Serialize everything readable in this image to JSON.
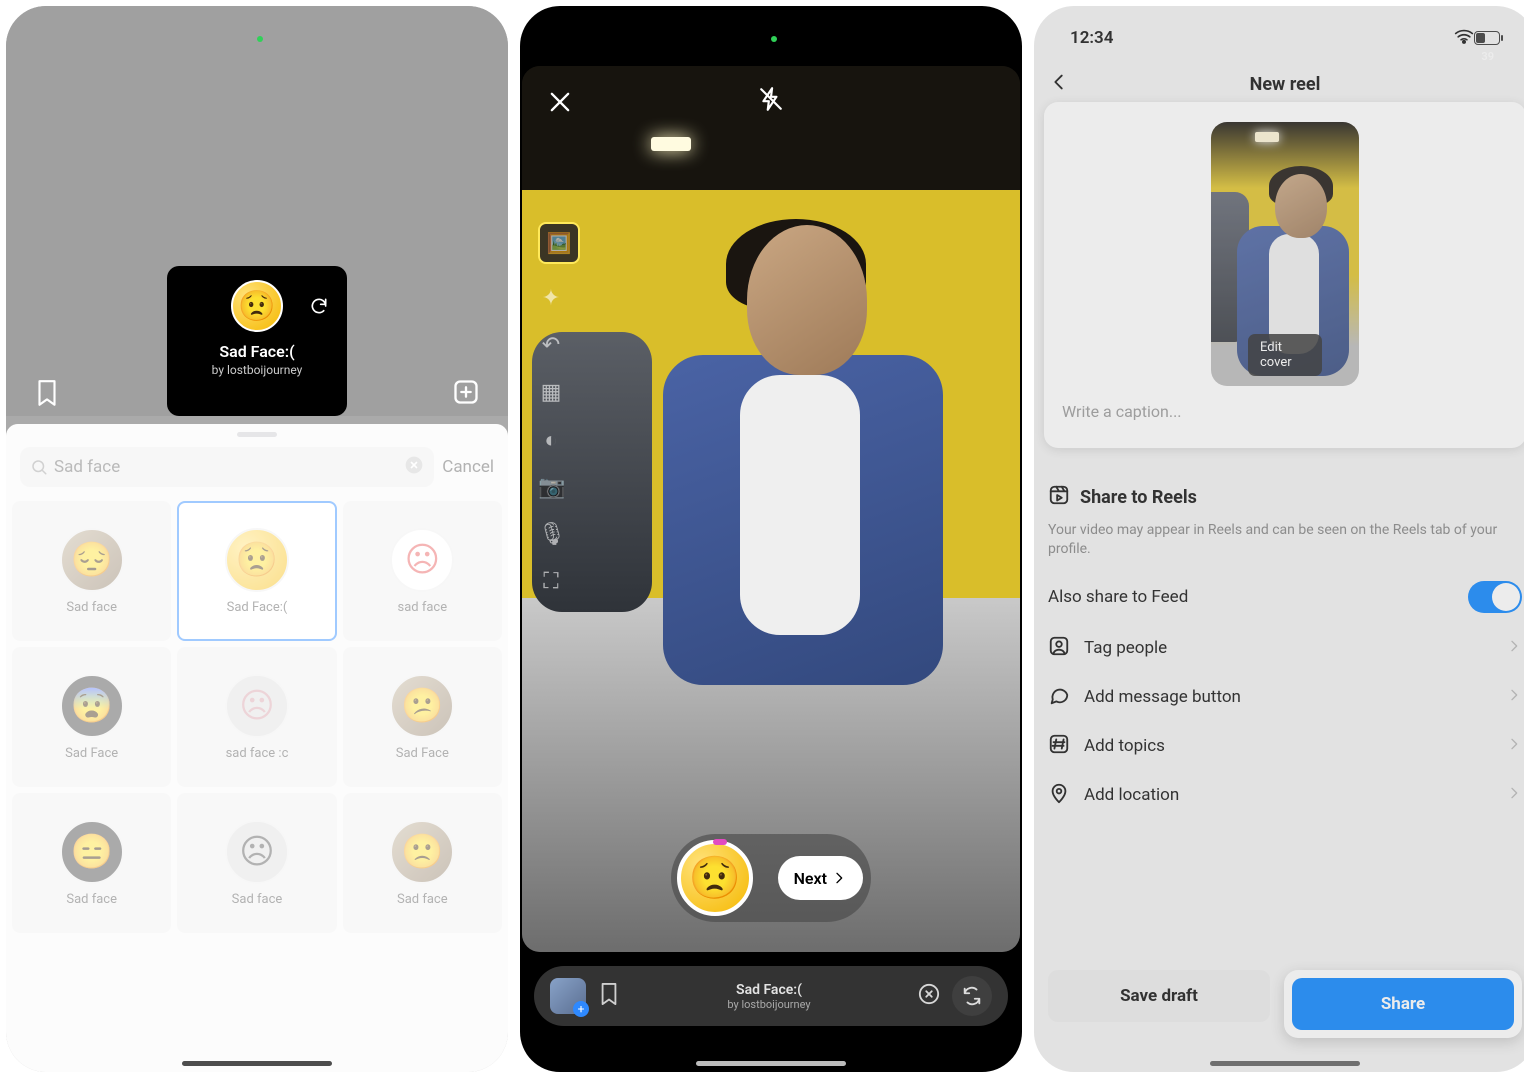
{
  "screen1": {
    "effect": {
      "title": "Sad Face:(",
      "author": "by lostboijourney"
    },
    "search": {
      "query": "Sad face",
      "cancel": "Cancel"
    },
    "results": [
      {
        "label": "Sad face"
      },
      {
        "label": "Sad Face:(",
        "selected": true
      },
      {
        "label": "sad face"
      },
      {
        "label": "Sad Face"
      },
      {
        "label": "sad face :c"
      },
      {
        "label": "Sad Face"
      },
      {
        "label": "Sad face"
      },
      {
        "label": "Sad face"
      },
      {
        "label": "Sad face"
      }
    ]
  },
  "screen2": {
    "next": "Next",
    "bottom_effect": {
      "title": "Sad Face:(",
      "author": "by lostboijourney"
    }
  },
  "screen3": {
    "status": {
      "time": "12:34",
      "battery_pct": "39"
    },
    "nav": {
      "title": "New reel"
    },
    "edit_cover": "Edit cover",
    "caption_placeholder": "Write a caption...",
    "share_to_reels": {
      "title": "Share to Reels",
      "desc": "Your video may appear in Reels and can be seen on the Reels tab of your profile."
    },
    "also_feed": "Also share to Feed",
    "rows": {
      "tag": "Tag people",
      "msg": "Add message button",
      "topics": "Add topics",
      "location": "Add location"
    },
    "footer": {
      "save": "Save draft",
      "share": "Share"
    }
  }
}
